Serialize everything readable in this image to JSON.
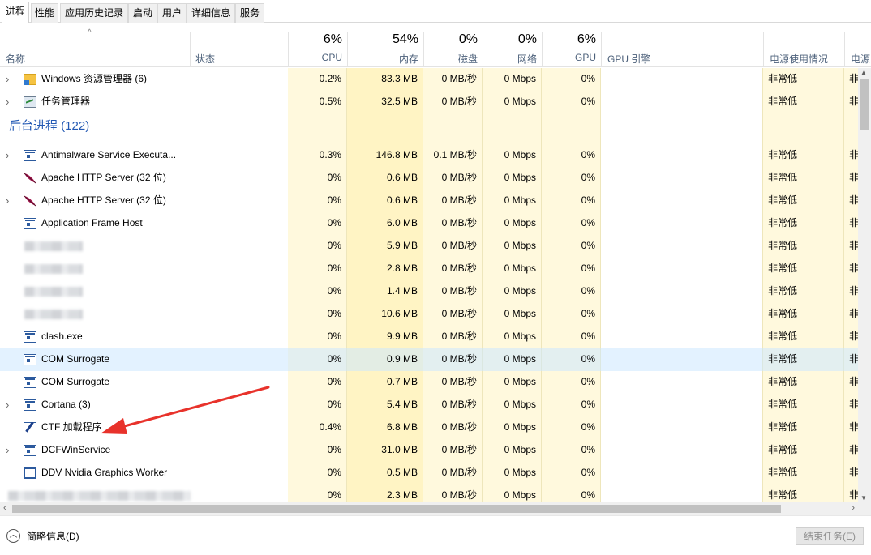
{
  "tabs": [
    {
      "label": "进程",
      "active": true
    },
    {
      "label": "性能"
    },
    {
      "label": "应用历史记录"
    },
    {
      "label": "启动"
    },
    {
      "label": "用户"
    },
    {
      "label": "详细信息"
    },
    {
      "label": "服务"
    }
  ],
  "header": {
    "sort_indicator": "^",
    "name": "名称",
    "status": "状态",
    "cpu_pct": "6%",
    "cpu": "CPU",
    "mem_pct": "54%",
    "mem": "内存",
    "disk_pct": "0%",
    "disk": "磁盘",
    "net_pct": "0%",
    "net": "网络",
    "gpu_pct": "6%",
    "gpu": "GPU",
    "gpu_engine": "GPU 引擎",
    "power": "电源使用情况",
    "power_trend": "电源"
  },
  "rows": [
    {
      "type": "proc",
      "expand": true,
      "icon": "folder-icon",
      "name": "Windows 资源管理器 (6)",
      "cpu": "0.2%",
      "mem": "83.3 MB",
      "disk": "0 MB/秒",
      "net": "0 Mbps",
      "gpu": "0%",
      "power": "非常低",
      "power2": "非"
    },
    {
      "type": "proc",
      "expand": true,
      "icon": "task-manager-icon",
      "name": "任务管理器",
      "cpu": "0.5%",
      "mem": "32.5 MB",
      "disk": "0 MB/秒",
      "net": "0 Mbps",
      "gpu": "0%",
      "power": "非常低",
      "power2": "非"
    },
    {
      "type": "group",
      "name": "后台进程 (122)"
    },
    {
      "type": "proc",
      "expand": true,
      "icon": "app-window-icon",
      "name": "Antimalware Service Executa...",
      "cpu": "0.3%",
      "mem": "146.8 MB",
      "disk": "0.1 MB/秒",
      "net": "0 Mbps",
      "gpu": "0%",
      "power": "非常低",
      "power2": "非"
    },
    {
      "type": "proc",
      "expand": false,
      "icon": "feather-icon",
      "name": "Apache HTTP Server (32 位)",
      "cpu": "0%",
      "mem": "0.6 MB",
      "disk": "0 MB/秒",
      "net": "0 Mbps",
      "gpu": "0%",
      "power": "非常低",
      "power2": "非"
    },
    {
      "type": "proc",
      "expand": true,
      "icon": "feather-icon",
      "name": "Apache HTTP Server (32 位)",
      "cpu": "0%",
      "mem": "0.6 MB",
      "disk": "0 MB/秒",
      "net": "0 Mbps",
      "gpu": "0%",
      "power": "非常低",
      "power2": "非"
    },
    {
      "type": "proc",
      "expand": false,
      "icon": "app-window-icon",
      "name": "Application Frame Host",
      "cpu": "0%",
      "mem": "6.0 MB",
      "disk": "0 MB/秒",
      "net": "0 Mbps",
      "gpu": "0%",
      "power": "非常低",
      "power2": "非"
    },
    {
      "type": "blurred",
      "cpu": "0%",
      "mem": "5.9 MB",
      "disk": "0 MB/秒",
      "net": "0 Mbps",
      "gpu": "0%",
      "power": "非常低",
      "power2": "非"
    },
    {
      "type": "blurred",
      "cpu": "0%",
      "mem": "2.8 MB",
      "disk": "0 MB/秒",
      "net": "0 Mbps",
      "gpu": "0%",
      "power": "非常低",
      "power2": "非"
    },
    {
      "type": "blurred",
      "cpu": "0%",
      "mem": "1.4 MB",
      "disk": "0 MB/秒",
      "net": "0 Mbps",
      "gpu": "0%",
      "power": "非常低",
      "power2": "非"
    },
    {
      "type": "blurred",
      "cpu": "0%",
      "mem": "10.6 MB",
      "disk": "0 MB/秒",
      "net": "0 Mbps",
      "gpu": "0%",
      "power": "非常低",
      "power2": "非"
    },
    {
      "type": "proc",
      "expand": false,
      "icon": "app-window-icon",
      "name": "clash.exe",
      "cpu": "0%",
      "mem": "9.9 MB",
      "disk": "0 MB/秒",
      "net": "0 Mbps",
      "gpu": "0%",
      "power": "非常低",
      "power2": "非"
    },
    {
      "type": "proc",
      "expand": false,
      "icon": "app-window-icon",
      "name": "COM Surrogate",
      "cpu": "0%",
      "mem": "0.9 MB",
      "disk": "0 MB/秒",
      "net": "0 Mbps",
      "gpu": "0%",
      "power": "非常低",
      "power2": "非",
      "highlight": true
    },
    {
      "type": "proc",
      "expand": false,
      "icon": "app-window-icon",
      "name": "COM Surrogate",
      "cpu": "0%",
      "mem": "0.7 MB",
      "disk": "0 MB/秒",
      "net": "0 Mbps",
      "gpu": "0%",
      "power": "非常低",
      "power2": "非"
    },
    {
      "type": "proc",
      "expand": true,
      "icon": "app-window-icon",
      "name": "Cortana (3)",
      "cpu": "0%",
      "mem": "5.4 MB",
      "disk": "0 MB/秒",
      "net": "0 Mbps",
      "gpu": "0%",
      "power": "非常低",
      "power2": "非"
    },
    {
      "type": "proc",
      "expand": false,
      "icon": "ctf-loader-icon",
      "name": "CTF 加载程序",
      "cpu": "0.4%",
      "mem": "6.8 MB",
      "disk": "0 MB/秒",
      "net": "0 Mbps",
      "gpu": "0%",
      "power": "非常低",
      "power2": "非"
    },
    {
      "type": "proc",
      "expand": true,
      "icon": "app-window-icon",
      "name": "DCFWinService",
      "cpu": "0%",
      "mem": "31.0 MB",
      "disk": "0 MB/秒",
      "net": "0 Mbps",
      "gpu": "0%",
      "power": "非常低",
      "power2": "非"
    },
    {
      "type": "proc",
      "expand": false,
      "icon": "ddv-icon",
      "name": "DDV Nvidia Graphics Worker",
      "cpu": "0%",
      "mem": "0.5 MB",
      "disk": "0 MB/秒",
      "net": "0 Mbps",
      "gpu": "0%",
      "power": "非常低",
      "power2": "非"
    },
    {
      "type": "blurred-wide",
      "cpu": "0%",
      "mem": "2.3 MB",
      "disk": "0 MB/秒",
      "net": "0 Mbps",
      "gpu": "0%",
      "power": "非常低",
      "power2": "非"
    }
  ],
  "footer": {
    "fewer_details": "简略信息(D)",
    "end_task": "结束任务(E)"
  },
  "colors": {
    "heat_light": "#fff9dd",
    "heat": "#fff4c4",
    "group_title": "#2359b4",
    "selection": "#cce8ff",
    "annotation": "#e8322b"
  }
}
